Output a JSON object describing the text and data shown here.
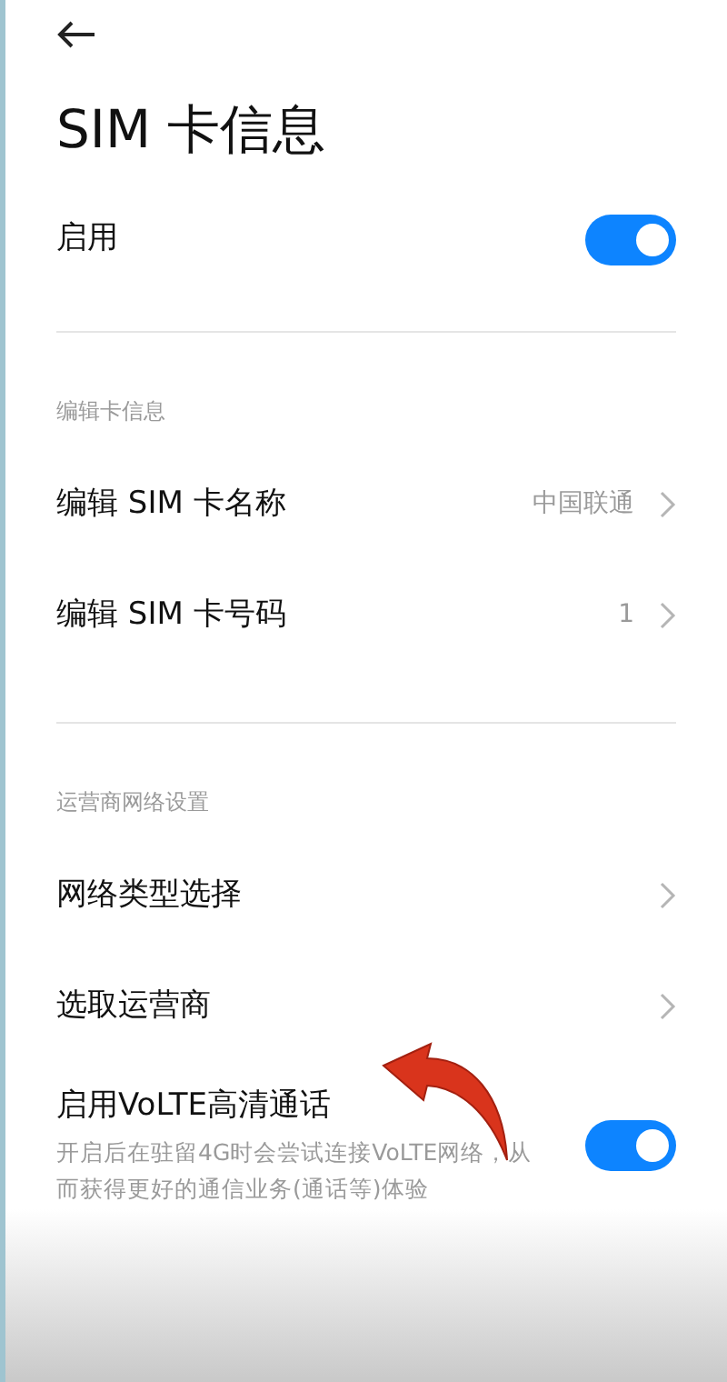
{
  "title": "SIM 卡信息",
  "enable": {
    "label": "启用",
    "on": true
  },
  "sections": [
    {
      "header": "编辑卡信息",
      "items": [
        {
          "label": "编辑 SIM 卡名称",
          "value": "中国联通"
        },
        {
          "label": "编辑 SIM 卡号码",
          "value": "1"
        }
      ]
    },
    {
      "header": "运营商网络设置",
      "items": [
        {
          "label": "网络类型选择"
        },
        {
          "label": "选取运营商"
        }
      ]
    }
  ],
  "volte": {
    "label": "启用VoLTE高清通话",
    "description": "开启后在驻留4G时会尝试连接VoLTE网络，从而获得更好的通信业务(通话等)体验",
    "on": true
  }
}
